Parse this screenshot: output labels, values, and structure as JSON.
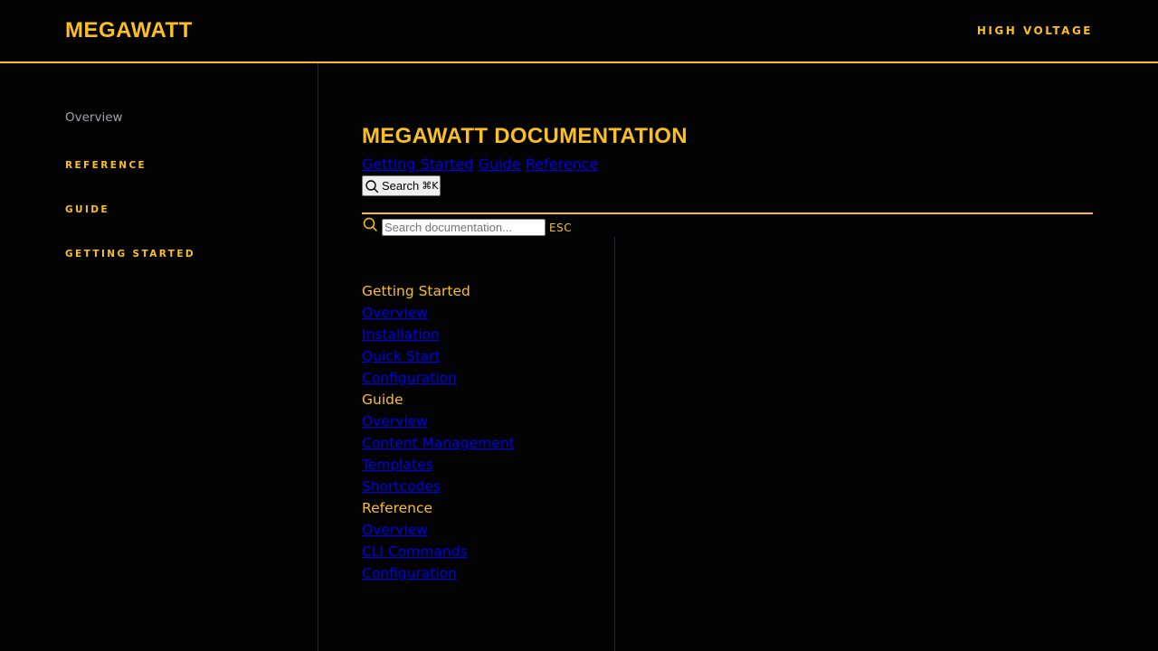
{
  "header": {
    "brand": "MEGAWATT",
    "tagline": "HIGH VOLTAGE"
  },
  "sidebar": {
    "overview": "Overview",
    "sections": [
      "REFERENCE",
      "GUIDE",
      "GETTING STARTED"
    ]
  },
  "main": {
    "title": "MEGAWATT DOCUMENTATION",
    "breadcrumbs": [
      "Getting Started",
      "Guide",
      "Reference"
    ],
    "search_button": {
      "label": "Search",
      "shortcut": "⌘K",
      "icon": "search-icon"
    },
    "search_bar": {
      "placeholder": "Search documentation...",
      "esc_label": "ESC",
      "icon": "search-icon"
    },
    "nav": {
      "groups": [
        {
          "title": "Getting Started",
          "links": [
            "Overview",
            "Installation",
            "Quick Start",
            "Configuration"
          ]
        },
        {
          "title": "Guide",
          "links": [
            "Overview",
            "Content Management",
            "Templates",
            "Shortcodes"
          ]
        },
        {
          "title": "Reference",
          "links": [
            "Overview",
            "CLI Commands",
            "Configuration"
          ]
        }
      ]
    }
  },
  "colors": {
    "background": "#030303",
    "accent": "#fbbf24",
    "link": "#0000ee",
    "muted_text": "#a1a1aa",
    "divider": "#26263a"
  }
}
